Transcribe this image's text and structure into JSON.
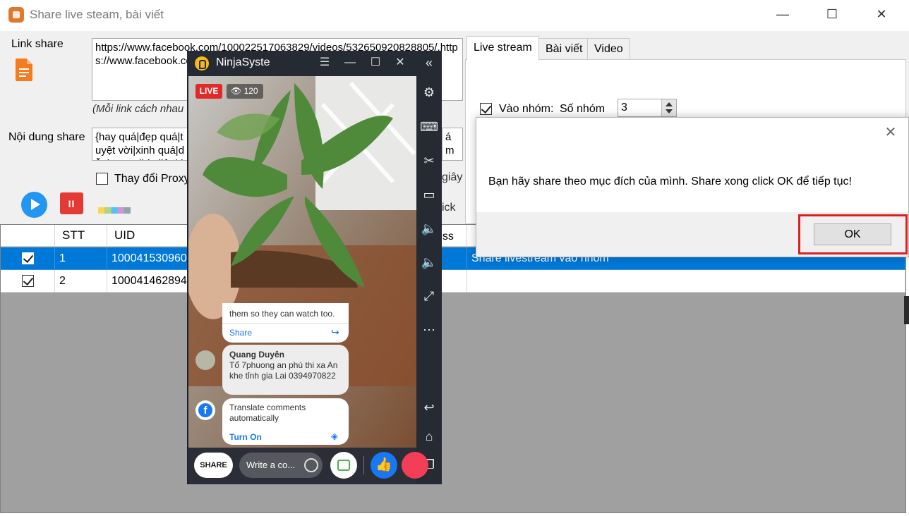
{
  "window": {
    "title": "Share live steam, bài viết",
    "controls": {
      "minimize": "—",
      "maximize": "☐",
      "close": "✕"
    }
  },
  "form": {
    "link_label": "Link share",
    "link_value": "https://www.facebook.com/100022517063829/videos/532650920828805/,https://www.facebook.com/100022517063829/videos/5326509209089/",
    "link_hint": "(Mỗi link cách nhau",
    "content_label": "Nội dung share",
    "content_value": "{hay quá|đẹp quá|tuyệt vời|xinh quá|dễ thương|kỳ diệu|thần kỳ|đỉnh|vi diệu|great}",
    "content_right_fragment": "ám",
    "proxy_label": "Thay đổi Proxy",
    "seconds_fragment": "giây",
    "click_fragment": "ick",
    "play_label": "play",
    "stop_label": "II"
  },
  "tabs": [
    {
      "label": "Live stream",
      "active": true
    },
    {
      "label": "Bài viết",
      "active": false
    },
    {
      "label": "Video",
      "active": false
    }
  ],
  "live_tab": {
    "group_checkbox_label": "Vào nhóm:",
    "group_checked": true,
    "group_count_label": "Số nhóm",
    "group_count_value": "3"
  },
  "grid": {
    "columns": [
      "",
      "STT",
      "UID",
      "ess",
      ""
    ],
    "rows": [
      {
        "checked": true,
        "stt": "1",
        "uid": "100041530960",
        "status": "Share livestream vào nhóm",
        "selected": true
      },
      {
        "checked": true,
        "stt": "2",
        "uid": "100041462894",
        "status": "",
        "selected": false
      }
    ]
  },
  "emulator": {
    "name": "NinjaSyste",
    "controls": {
      "menu": "☰",
      "minimize": "—",
      "maximize": "☐",
      "close": "✕",
      "collapse": "«"
    },
    "side_icons": [
      "settings-icon",
      "keyboard-icon",
      "scissors-icon",
      "video-record-icon",
      "volume-up-icon",
      "volume-down-icon",
      "fullscreen-icon",
      "more-icon",
      "back-icon",
      "home-icon",
      "recent-apps-icon"
    ],
    "live_badge": "LIVE",
    "viewers": "120",
    "comments": {
      "share_card_text": "them so they can watch too.",
      "share_card_link": "Share",
      "commenter_name": "Quang Duyên",
      "comment_text": "Tổ 7phuong an phú thi xa An khe tỉnh gia Lai 0394970822",
      "translate_text": "Translate comments automatically",
      "translate_link": "Turn On"
    },
    "bottom_bar": {
      "share_button": "SHARE",
      "write_placeholder": "Write a co..."
    }
  },
  "dialog": {
    "message": "Bạn hãy share theo mục đích của mình. Share xong click OK để tiếp tục!",
    "ok_label": "OK",
    "close_label": "✕"
  }
}
